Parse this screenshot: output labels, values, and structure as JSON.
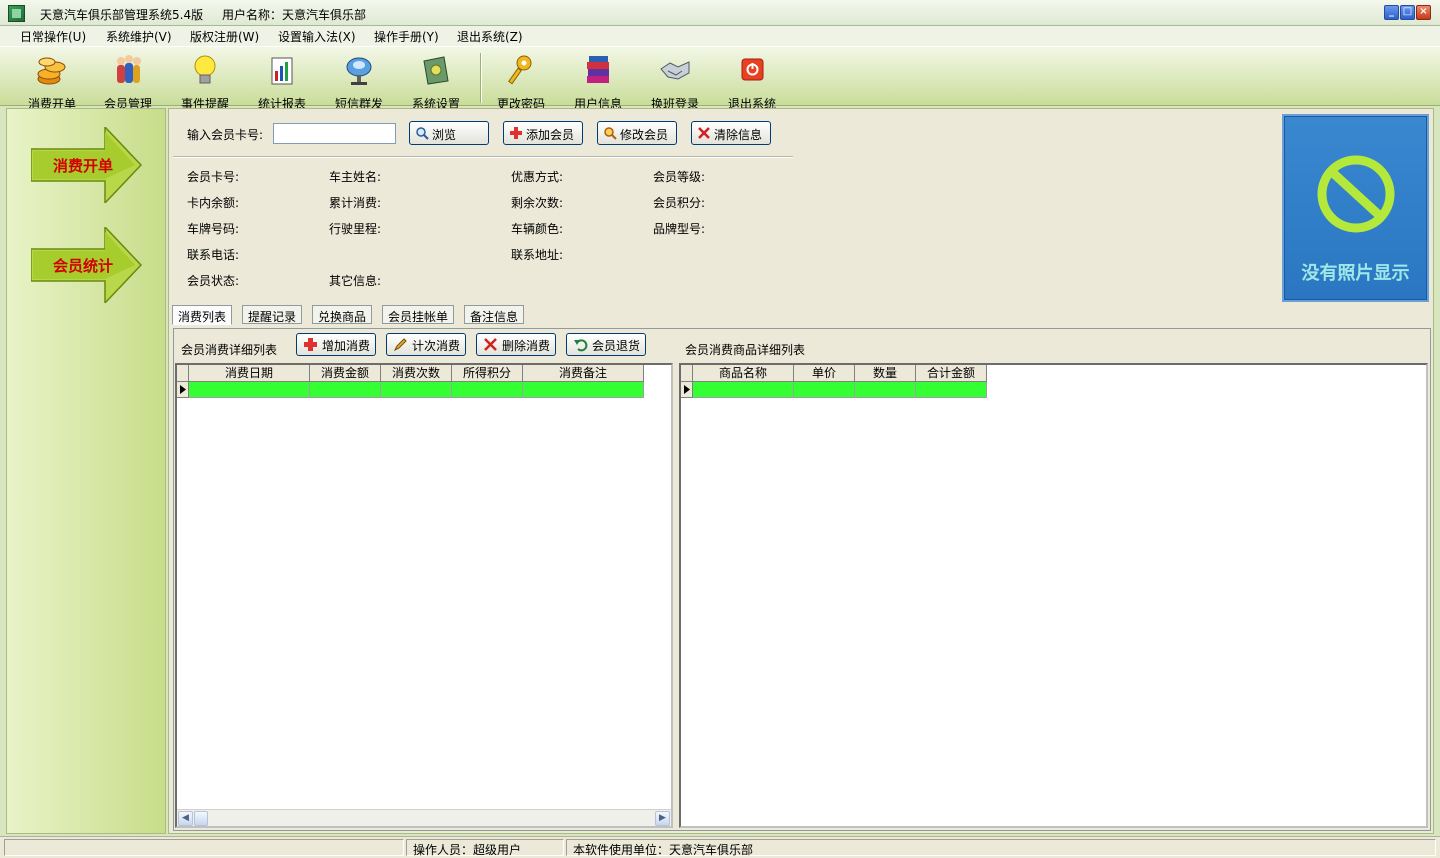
{
  "window": {
    "title": "天意汽车俱乐部管理系统5.4版",
    "username_text": "用户名称：天意汽车俱乐部"
  },
  "menu": [
    "日常操作(U)",
    "系统维护(V)",
    "版权注册(W)",
    "设置输入法(X)",
    "操作手册(Y)",
    "退出系统(Z)"
  ],
  "toolbar": [
    {
      "label": "消费开单",
      "icon": "coins-icon"
    },
    {
      "label": "会员管理",
      "icon": "members-icon"
    },
    {
      "label": "事件提醒",
      "icon": "lightbulb-icon"
    },
    {
      "label": "统计报表",
      "icon": "report-icon"
    },
    {
      "label": "短信群发",
      "icon": "satellite-icon"
    },
    {
      "label": "系统设置",
      "icon": "settings-icon"
    },
    {
      "label": "更改密码",
      "icon": "key-icon"
    },
    {
      "label": "用户信息",
      "icon": "books-icon"
    },
    {
      "label": "换班登录",
      "icon": "handshake-icon"
    },
    {
      "label": "退出系统",
      "icon": "power-icon"
    }
  ],
  "left_nav": [
    "消费开单",
    "会员统计"
  ],
  "search": {
    "label": "输入会员卡号:",
    "value": "",
    "buttons": [
      "浏览",
      "添加会员",
      "修改会员",
      "清除信息"
    ]
  },
  "member_info": {
    "card_no": "会员卡号:",
    "owner_name": "车主姓名:",
    "discount": "优惠方式:",
    "level": "会员等级:",
    "balance": "卡内余额:",
    "total_spent": "累计消费:",
    "remaining_times": "剩余次数:",
    "points": "会员积分:",
    "plate": "车牌号码:",
    "mileage": "行驶里程:",
    "car_color": "车辆颜色:",
    "model": "品牌型号:",
    "phone": "联系电话:",
    "address": "联系地址:",
    "status": "会员状态:",
    "other": "其它信息:"
  },
  "photo": {
    "text": "没有照片显示"
  },
  "tabs": [
    "消费列表",
    "提醒记录",
    "兑换商品",
    "会员挂帐单",
    "备注信息"
  ],
  "consume_panel": {
    "title": "会员消费详细列表",
    "buttons": [
      "增加消费",
      "计次消费",
      "删除消费",
      "会员退货"
    ],
    "columns": [
      "消费日期",
      "消费金额",
      "消费次数",
      "所得积分",
      "消费备注"
    ]
  },
  "goods_panel": {
    "title": "会员消费商品详细列表",
    "columns": [
      "商品名称",
      "单价",
      "数量",
      "合计金额"
    ]
  },
  "status": {
    "operator": "操作人员：超级用户",
    "unit": "本软件使用单位：天意汽车俱乐部"
  },
  "colors": {
    "accent_green": "#33ff33",
    "nav_text": "#d40000",
    "toolbar_bg": "#c9dd9a"
  }
}
